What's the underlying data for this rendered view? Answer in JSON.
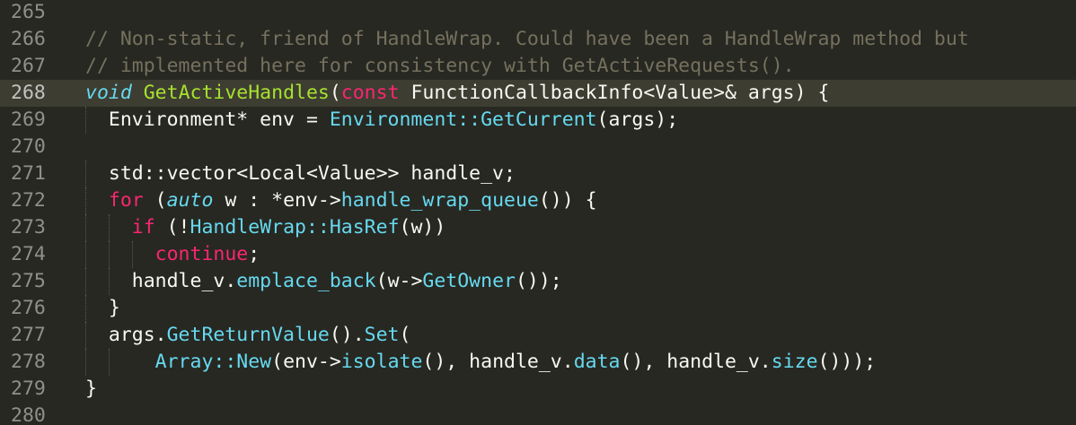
{
  "editor": {
    "language": "cpp",
    "theme_colors": {
      "background": "#272822",
      "current_line": "#3e3d32",
      "line_number": "#90908a",
      "comment": "#75715e",
      "keyword": "#f92672",
      "storage_type": "#66d9ef",
      "function_name": "#a6e22e",
      "call": "#66d9ef",
      "plain": "#f8f8f2"
    },
    "current_line_number": "268",
    "lines": [
      {
        "n": "265",
        "tokens": []
      },
      {
        "n": "266",
        "tokens": [
          {
            "t": "// Non-static, friend of HandleWrap. Could have been a HandleWrap method but",
            "c": "cm"
          }
        ]
      },
      {
        "n": "267",
        "tokens": [
          {
            "t": "// implemented here for consistency with GetActiveRequests().",
            "c": "cm"
          }
        ]
      },
      {
        "n": "268",
        "tokens": [
          {
            "t": "void",
            "c": "st"
          },
          {
            "t": " ",
            "c": "pl"
          },
          {
            "t": "GetActiveHandles",
            "c": "fn"
          },
          {
            "t": "(",
            "c": "pl"
          },
          {
            "t": "const",
            "c": "kw"
          },
          {
            "t": " FunctionCallbackInfo<Value>& args) {",
            "c": "pl"
          }
        ]
      },
      {
        "n": "269",
        "tokens": [
          {
            "t": "  Environment* env = ",
            "c": "pl"
          },
          {
            "t": "Environment::GetCurrent",
            "c": "ca"
          },
          {
            "t": "(args);",
            "c": "pl"
          }
        ]
      },
      {
        "n": "270",
        "tokens": []
      },
      {
        "n": "271",
        "tokens": [
          {
            "t": "  std::vector<Local<Value>> handle_v;",
            "c": "pl"
          }
        ]
      },
      {
        "n": "272",
        "tokens": [
          {
            "t": "  ",
            "c": "pl"
          },
          {
            "t": "for",
            "c": "kw"
          },
          {
            "t": " (",
            "c": "pl"
          },
          {
            "t": "auto",
            "c": "st"
          },
          {
            "t": " w : *env->",
            "c": "pl"
          },
          {
            "t": "handle_wrap_queue",
            "c": "ca"
          },
          {
            "t": "()) {",
            "c": "pl"
          }
        ]
      },
      {
        "n": "273",
        "tokens": [
          {
            "t": "    ",
            "c": "pl"
          },
          {
            "t": "if",
            "c": "kw"
          },
          {
            "t": " (!",
            "c": "pl"
          },
          {
            "t": "HandleWrap::HasRef",
            "c": "ca"
          },
          {
            "t": "(w))",
            "c": "pl"
          }
        ]
      },
      {
        "n": "274",
        "tokens": [
          {
            "t": "      ",
            "c": "pl"
          },
          {
            "t": "continue",
            "c": "kw"
          },
          {
            "t": ";",
            "c": "pl"
          }
        ]
      },
      {
        "n": "275",
        "tokens": [
          {
            "t": "    handle_v.",
            "c": "pl"
          },
          {
            "t": "emplace_back",
            "c": "ca"
          },
          {
            "t": "(w->",
            "c": "pl"
          },
          {
            "t": "GetOwner",
            "c": "ca"
          },
          {
            "t": "());",
            "c": "pl"
          }
        ]
      },
      {
        "n": "276",
        "tokens": [
          {
            "t": "  }",
            "c": "pl"
          }
        ]
      },
      {
        "n": "277",
        "tokens": [
          {
            "t": "  args.",
            "c": "pl"
          },
          {
            "t": "GetReturnValue",
            "c": "ca"
          },
          {
            "t": "().",
            "c": "pl"
          },
          {
            "t": "Set",
            "c": "ca"
          },
          {
            "t": "(",
            "c": "pl"
          }
        ]
      },
      {
        "n": "278",
        "tokens": [
          {
            "t": "      ",
            "c": "pl"
          },
          {
            "t": "Array::New",
            "c": "ca"
          },
          {
            "t": "(env->",
            "c": "pl"
          },
          {
            "t": "isolate",
            "c": "ca"
          },
          {
            "t": "(), handle_v.",
            "c": "pl"
          },
          {
            "t": "data",
            "c": "ca"
          },
          {
            "t": "(), handle_v.",
            "c": "pl"
          },
          {
            "t": "size",
            "c": "ca"
          },
          {
            "t": "()));",
            "c": "pl"
          }
        ]
      },
      {
        "n": "279",
        "tokens": [
          {
            "t": "}",
            "c": "pl"
          }
        ]
      },
      {
        "n": "280",
        "tokens": []
      }
    ]
  }
}
